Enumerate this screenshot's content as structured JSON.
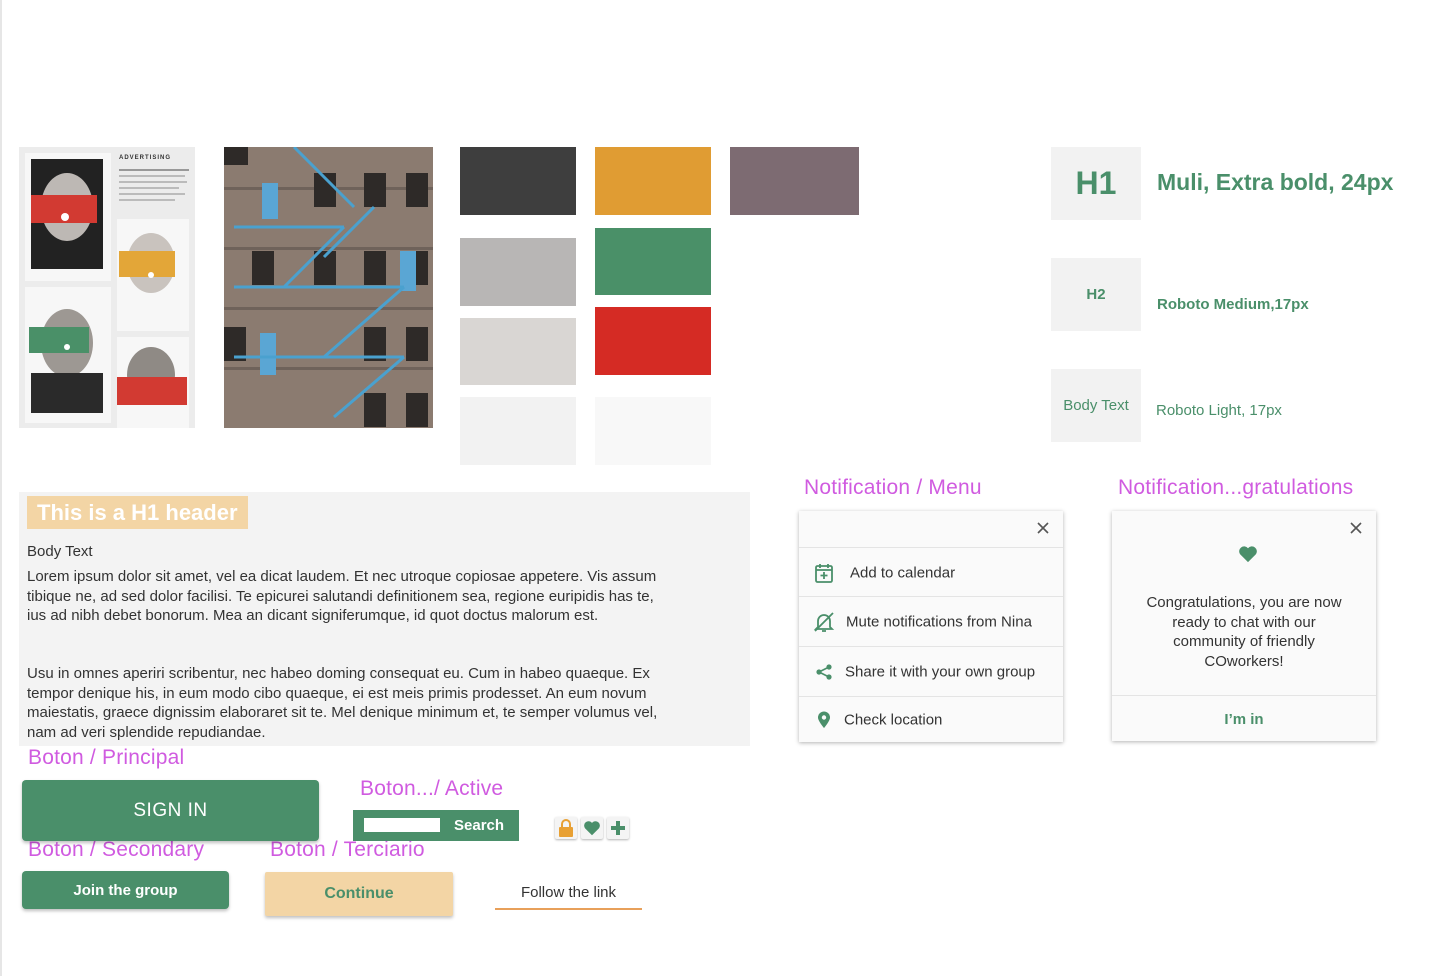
{
  "colors": {
    "primary_green": "#4a8f6a",
    "peach": "#f3d5a5",
    "label_magenta": "#d05be0",
    "link_underline": "#e8a05a"
  },
  "swatches": [
    {
      "name": "charcoal",
      "color": "#3e3e3e"
    },
    {
      "name": "orange",
      "color": "#e09c33"
    },
    {
      "name": "mauve-grey",
      "color": "#7d6b72"
    },
    {
      "name": "mid-grey",
      "color": "#b8b6b5"
    },
    {
      "name": "green",
      "color": "#4a9068"
    },
    {
      "name": "light-grey",
      "color": "#d9d6d3"
    },
    {
      "name": "red",
      "color": "#d52b24"
    },
    {
      "name": "off-white-1",
      "color": "#f2f2f2"
    },
    {
      "name": "off-white-2",
      "color": "#f8f8f8"
    }
  ],
  "poster": {
    "title": "ADVERTISING"
  },
  "typography": {
    "h1": {
      "sample": "H1",
      "spec": "Muli, Extra bold, 24px"
    },
    "h2": {
      "sample": "H2",
      "spec": "Roboto Medium,17px"
    },
    "body": {
      "sample": "Body Text",
      "spec": "Roboto Light, 17px"
    }
  },
  "text_panel": {
    "h1": "This is a H1 header",
    "body_label": "Body Text",
    "paragraph_1": "Lorem ipsum dolor sit amet, vel ea dicat laudem. Et nec utroque copiosae appetere. Vis assum tibique ne, ad sed dolor facilisi. Te epicurei salutandi definitionem sea, regione euripidis has te, ius ad nibh debet bonorum. Mea an dicant signiferumque, id quot doctus malorum est.",
    "paragraph_2": "Usu in omnes aperiri scribentur, nec habeo doming consequat eu. Cum in habeo quaeque. Ex tempor denique his, in eum modo cibo quaeque, ei est meis primis prodesset. An eum novum maiestatis, graece dignissim elaboraret sit te. Mel denique minimum et, te semper volumus vel, nam ad veri splendide repudiandae."
  },
  "labels": {
    "boton_principal": "Boton / Principal",
    "boton_active": "Boton.../ Active",
    "boton_secondary": "Boton / Secondary",
    "boton_terciario": "Boton / Terciario",
    "notification_menu": "Notification / Menu",
    "notification_congrats": "Notification...gratulations"
  },
  "buttons": {
    "sign_in": "SIGN IN",
    "search": "Search",
    "join": "Join the group",
    "continue": "Continue",
    "follow_link": "Follow the link"
  },
  "search": {
    "value": ""
  },
  "icon_buttons": [
    {
      "icon": "lock-icon",
      "color": "#e8a033"
    },
    {
      "icon": "heart-icon",
      "color": "#4a8f6a"
    },
    {
      "icon": "plus-icon",
      "color": "#4a8f6a"
    }
  ],
  "notification_menu": {
    "close_icon": "close-icon",
    "items": [
      {
        "icon": "calendar-add-icon",
        "label": "Add to calendar"
      },
      {
        "icon": "bell-off-icon",
        "label": "Mute notifications from Nina"
      },
      {
        "icon": "share-icon",
        "label": "Share it with your own group"
      },
      {
        "icon": "location-pin-icon",
        "label": "Check location"
      }
    ]
  },
  "notification_congrats": {
    "close_icon": "close-icon",
    "icon": "heart-icon",
    "message": "Congratulations, you are now ready to chat with our community of friendly COworkers!",
    "action": "I’m in"
  }
}
